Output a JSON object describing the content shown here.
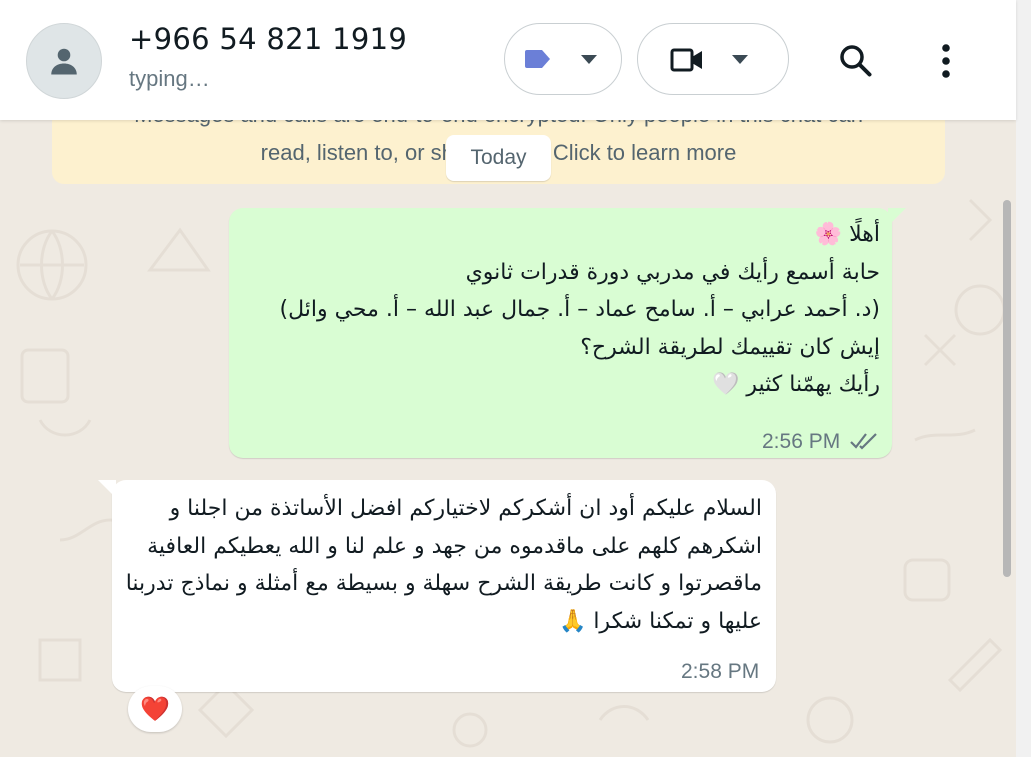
{
  "header": {
    "contact_name": "+966 54 821 1919",
    "status": "typing…"
  },
  "notice": {
    "line1": "Messages and calls are end-to-end encrypted. Only people in this chat can",
    "line2": "read, listen to, or share them. Click to learn more"
  },
  "date_chip": "Today",
  "messages": [
    {
      "direction": "outgoing",
      "text": "أهلًا 🌸\nحابة أسمع رأيك في مدربي دورة قدرات ثانوي\n(د. أحمد عرابي – أ. سامح عماد – أ. جمال عبد الله – أ. محي وائل)\nإيش كان تقييمك لطريقة الشرح؟\nرأيك يهمّنا كثير 🤍",
      "time": "2:56 PM",
      "status": "read"
    },
    {
      "direction": "incoming",
      "text": "السلام عليكم أود ان أشكركم لاختياركم افضل الأساتذة من اجلنا و اشكرهم كلهم على ماقدموه من جهد و علم لنا و الله يعطيكم العافية ماقصرتوا و كانت طريقة الشرح سهلة و بسيطة مع أمثلة و نماذج تدربنا عليها و تمكنا شكرا 🙏",
      "time": "2:58 PM"
    }
  ],
  "reaction": {
    "emoji": "❤️"
  },
  "colors": {
    "outgoing_bubble": "#d9fdd3",
    "incoming_bubble": "#ffffff",
    "chat_background": "#efeae2",
    "notice_background": "#fdf1cf",
    "label_icon": "#6b7fd7",
    "read_ticks": "#667781"
  },
  "icons": [
    "avatar-icon",
    "label-icon",
    "chevron-down-icon",
    "video-camera-icon",
    "search-icon",
    "more-options-icon",
    "double-check-icon"
  ]
}
